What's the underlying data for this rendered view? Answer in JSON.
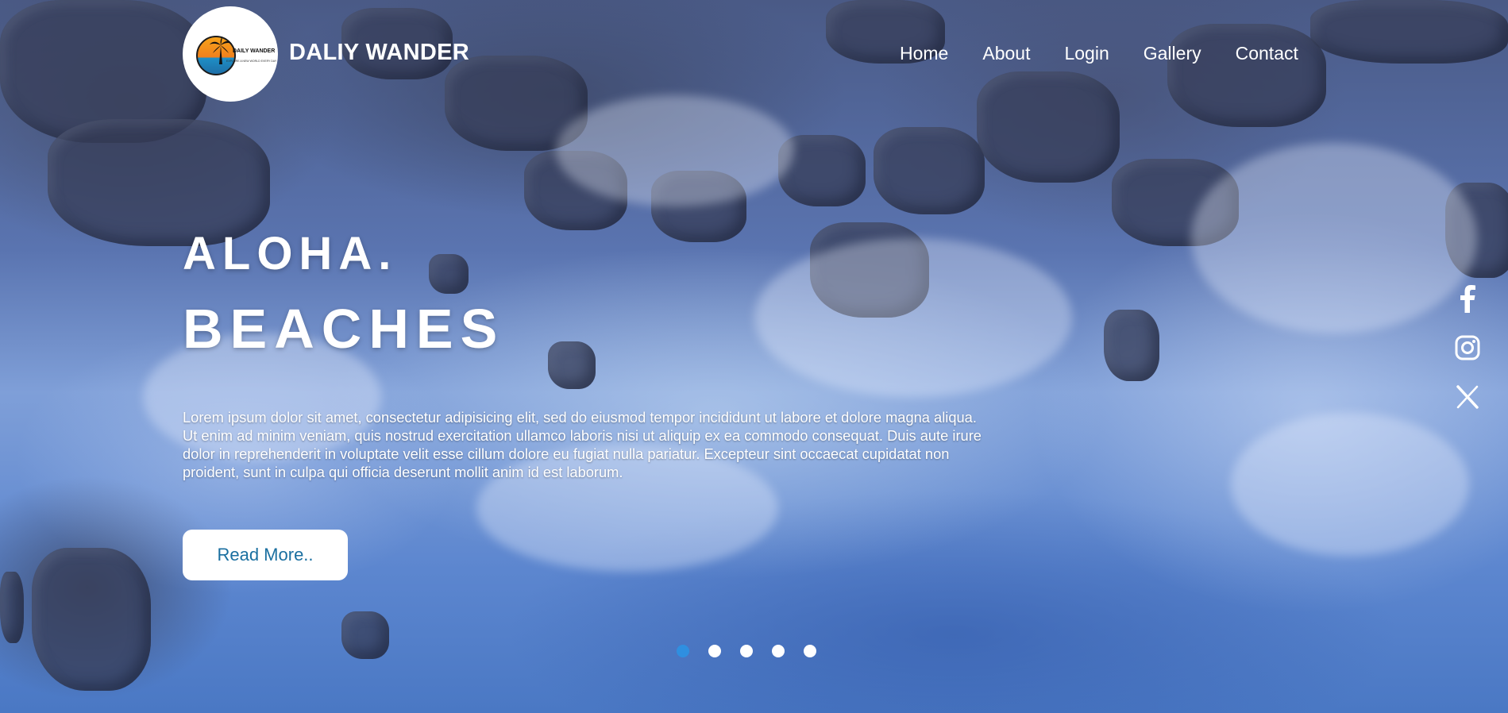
{
  "header": {
    "logo": {
      "text": "DAILY WANDER",
      "tagline": "EXPLORE A NEW WORLD EVERY DAY"
    },
    "brand": "DALIY WANDER",
    "nav": [
      {
        "label": "Home"
      },
      {
        "label": "About"
      },
      {
        "label": "Login"
      },
      {
        "label": "Gallery"
      },
      {
        "label": "Contact"
      }
    ]
  },
  "hero": {
    "title_line1": "ALOHA.",
    "title_line2": "BEACHES",
    "description": "Lorem ipsum dolor sit amet, consectetur adipisicing elit, sed do eiusmod tempor incididunt ut labore et dolore magna aliqua. Ut enim ad minim veniam, quis nostrud exercitation ullamco laboris nisi ut aliquip ex ea commodo consequat. Duis aute irure dolor in reprehenderit in voluptate velit esse cillum dolore eu fugiat nulla pariatur. Excepteur sint occaecat cupidatat non proident, sunt in culpa qui officia deserunt mollit anim id est laborum.",
    "cta_label": "Read More.."
  },
  "slider": {
    "count": 5,
    "active_index": 0,
    "active_color": "#2f8fe0"
  },
  "social": [
    {
      "icon": "facebook-icon"
    },
    {
      "icon": "instagram-icon"
    },
    {
      "icon": "x-twitter-icon"
    }
  ],
  "colors": {
    "button_text": "#1a6fa0",
    "text": "#ffffff"
  }
}
